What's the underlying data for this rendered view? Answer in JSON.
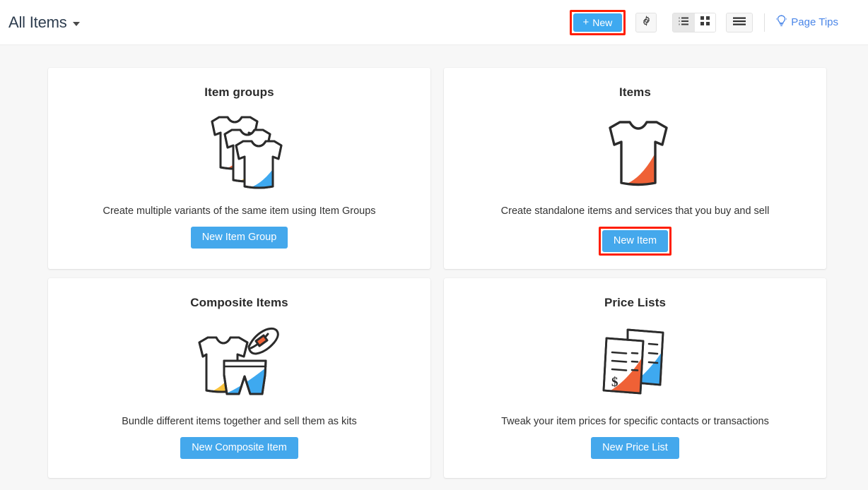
{
  "header": {
    "title": "All Items",
    "caret_icon": "chevron-down-icon",
    "new_button": {
      "label": "New",
      "plus": "+",
      "accent": "#3ea9f0",
      "highlight_color": "#ff1e00"
    },
    "settings_icon": "gear-icon",
    "view_toggle": {
      "list_icon": "list-view-icon",
      "grid_icon": "grid-view-icon",
      "selected": "list"
    },
    "menu_icon": "hamburger-menu-icon",
    "page_tips": {
      "label": "Page Tips",
      "icon": "lightbulb-icon",
      "color": "#4a86e8"
    }
  },
  "main": {
    "background": "#f7f7f7",
    "cards": [
      {
        "title": "Item groups",
        "description": "Create multiple variants of the same item using Item Groups",
        "button_label": "New Item Group",
        "illustration": "three-tshirts-icon",
        "highlighted": false
      },
      {
        "title": "Items",
        "description": "Create standalone items and services that you buy and sell",
        "button_label": "New Item",
        "illustration": "tshirt-icon",
        "highlighted": true
      },
      {
        "title": "Composite Items",
        "description": "Bundle different items together and sell them as kits",
        "button_label": "New Composite Item",
        "illustration": "tshirt-shorts-cap-icon",
        "highlighted": false
      },
      {
        "title": "Price Lists",
        "description": "Tweak your item prices for specific contacts or transactions",
        "button_label": "New Price List",
        "illustration": "price-documents-icon",
        "highlighted": false
      }
    ]
  },
  "colors": {
    "orange": "#ef6136",
    "yellow": "#f9c23c",
    "blue": "#3ea9f0",
    "outline": "#2b2b2b",
    "button_blue": "#44a8ec",
    "highlight_red": "#ff1e00"
  }
}
